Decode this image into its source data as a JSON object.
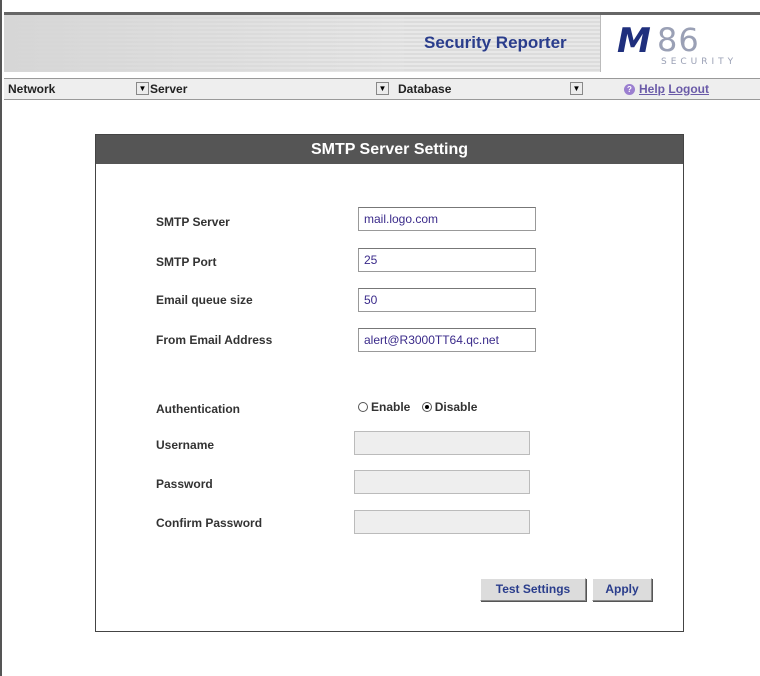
{
  "app": {
    "title": "Security Reporter",
    "logo": {
      "mark": "M",
      "number": "86",
      "tagline": "SECURITY"
    }
  },
  "nav": {
    "items": [
      {
        "label": "Network"
      },
      {
        "label": "Server"
      },
      {
        "label": "Database"
      }
    ],
    "help_label": "Help",
    "logout_label": "Logout"
  },
  "panel": {
    "title": "SMTP Server Setting",
    "fields": {
      "smtp_server": {
        "label": "SMTP Server",
        "value": "mail.logo.com"
      },
      "smtp_port": {
        "label": "SMTP Port",
        "value": "25"
      },
      "queue_size": {
        "label": "Email queue size",
        "value": "50"
      },
      "from_email": {
        "label": "From Email Address",
        "value": "alert@R3000TT64.qc.net"
      }
    },
    "authentication": {
      "label": "Authentication",
      "options": [
        {
          "label": "Enable",
          "selected": false
        },
        {
          "label": "Disable",
          "selected": true
        }
      ]
    },
    "username": {
      "label": "Username",
      "value": ""
    },
    "password": {
      "label": "Password",
      "value": ""
    },
    "confirm_password": {
      "label": "Confirm Password",
      "value": ""
    },
    "buttons": {
      "test": "Test Settings",
      "apply": "Apply"
    }
  },
  "colors": {
    "title_blue": "#2a3d8c",
    "header_gray": "#555555",
    "link_purple": "#6a5aa8"
  }
}
